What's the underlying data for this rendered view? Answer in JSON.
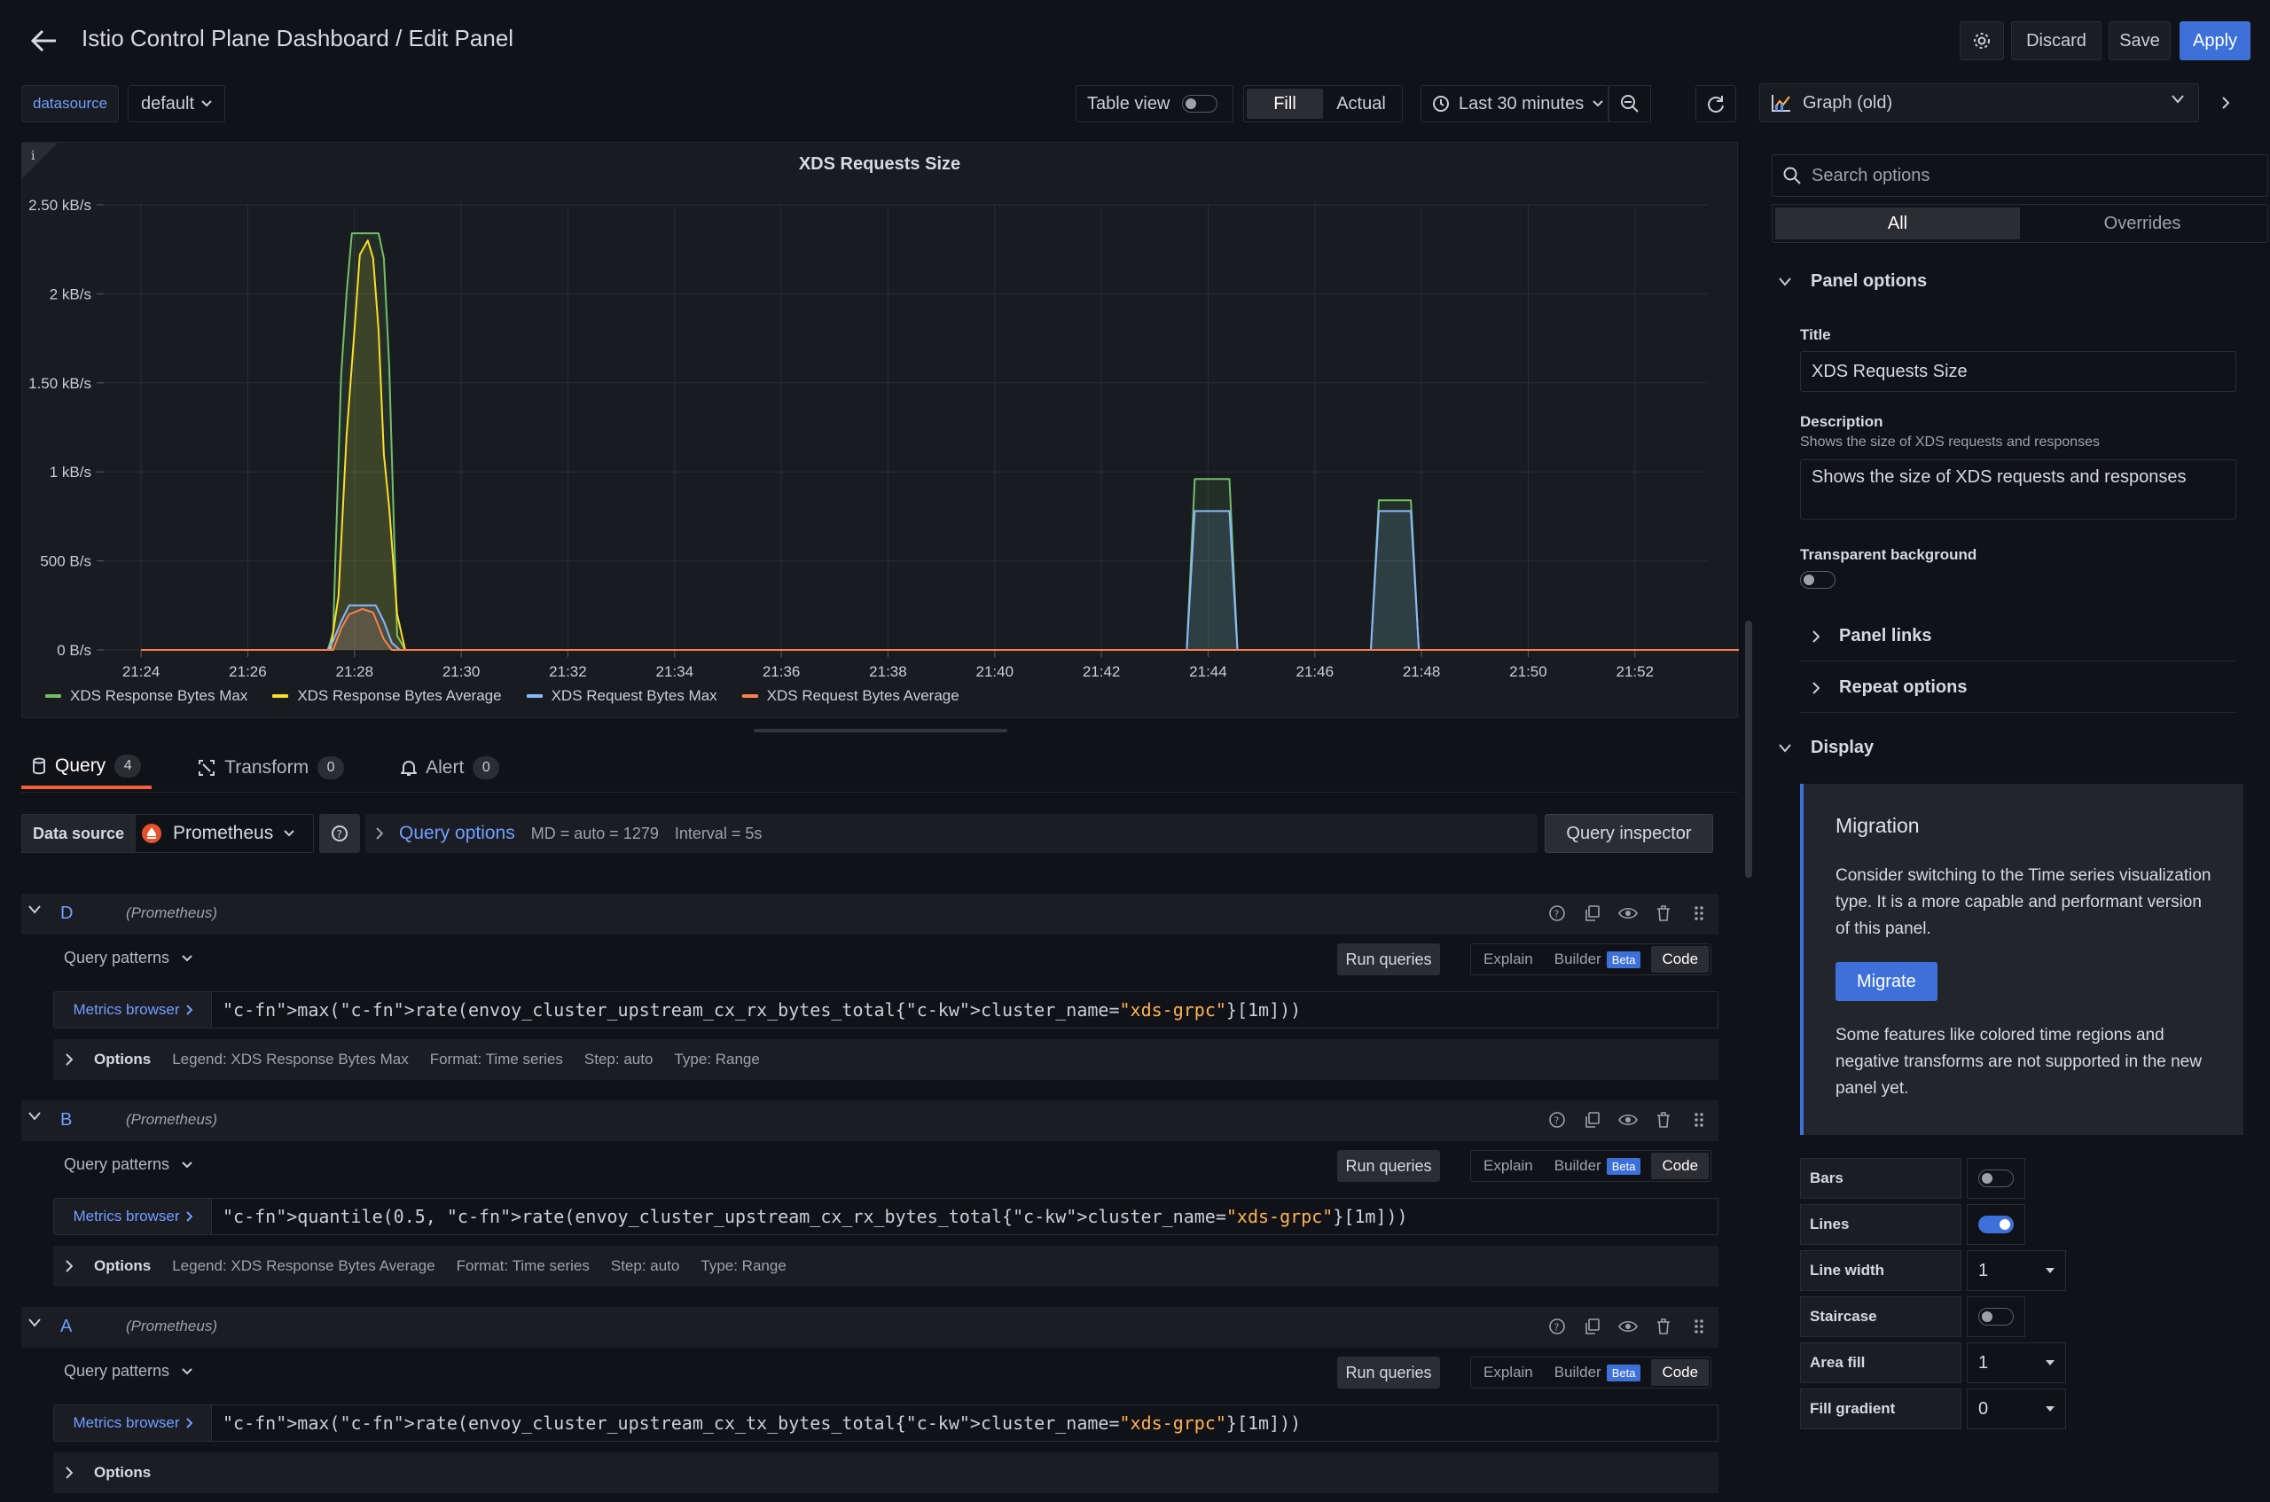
{
  "header": {
    "title": "Istio Control Plane Dashboard / Edit Panel",
    "discard": "Discard",
    "save": "Save",
    "apply": "Apply"
  },
  "toolbar": {
    "datasource_label": "datasource",
    "datasource_value": "default",
    "table_view": "Table view",
    "fill": "Fill",
    "actual": "Actual",
    "time_range": "Last 30 minutes",
    "visualization": "Graph (old)"
  },
  "chart_data": {
    "type": "line",
    "title": "XDS Requests Size",
    "x_ticks": [
      "21:24",
      "21:26",
      "21:28",
      "21:30",
      "21:32",
      "21:34",
      "21:36",
      "21:38",
      "21:40",
      "21:42",
      "21:44",
      "21:46",
      "21:48",
      "21:50",
      "21:52"
    ],
    "y_ticks": [
      "0 B/s",
      "500 B/s",
      "1 kB/s",
      "1.50 kB/s",
      "2 kB/s",
      "2.50 kB/s"
    ],
    "ylim": [
      0,
      2500
    ],
    "x_unit": "minutes since 21:24",
    "grid": true,
    "legend_position": "bottom-left",
    "series": [
      {
        "name": "XDS Response Bytes Max",
        "color": "#73bf69",
        "points": [
          [
            0,
            0
          ],
          [
            3.5,
            0
          ],
          [
            3.6,
            100
          ],
          [
            3.75,
            1540
          ],
          [
            3.85,
            2000
          ],
          [
            3.95,
            2340
          ],
          [
            4.45,
            2340
          ],
          [
            4.55,
            2200
          ],
          [
            4.65,
            1600
          ],
          [
            4.8,
            80
          ],
          [
            4.95,
            0
          ],
          [
            19.6,
            0
          ],
          [
            19.75,
            960
          ],
          [
            20.4,
            960
          ],
          [
            20.55,
            0
          ],
          [
            23.05,
            0
          ],
          [
            23.2,
            840
          ],
          [
            23.8,
            840
          ],
          [
            23.95,
            0
          ],
          [
            30,
            0
          ]
        ]
      },
      {
        "name": "XDS Response Bytes Average",
        "color": "#fade2a",
        "points": [
          [
            0,
            0
          ],
          [
            3.55,
            0
          ],
          [
            3.7,
            300
          ],
          [
            3.85,
            1200
          ],
          [
            4.0,
            1800
          ],
          [
            4.1,
            2220
          ],
          [
            4.25,
            2300
          ],
          [
            4.35,
            2200
          ],
          [
            4.45,
            1800
          ],
          [
            4.55,
            1100
          ],
          [
            4.65,
            800
          ],
          [
            4.8,
            200
          ],
          [
            4.95,
            0
          ],
          [
            30,
            0
          ]
        ]
      },
      {
        "name": "XDS Request Bytes Max",
        "color": "#8ab8ff",
        "points": [
          [
            0,
            0
          ],
          [
            3.5,
            0
          ],
          [
            3.6,
            50
          ],
          [
            3.75,
            160
          ],
          [
            3.9,
            250
          ],
          [
            4.4,
            250
          ],
          [
            4.55,
            160
          ],
          [
            4.7,
            40
          ],
          [
            4.85,
            0
          ],
          [
            19.6,
            0
          ],
          [
            19.75,
            780
          ],
          [
            20.4,
            780
          ],
          [
            20.55,
            0
          ],
          [
            23.05,
            0
          ],
          [
            23.2,
            780
          ],
          [
            23.8,
            780
          ],
          [
            23.95,
            0
          ],
          [
            30,
            0
          ]
        ]
      },
      {
        "name": "XDS Request Bytes Average",
        "color": "#ff7f4a",
        "points": [
          [
            0,
            0
          ],
          [
            3.6,
            0
          ],
          [
            3.75,
            120
          ],
          [
            3.9,
            200
          ],
          [
            4.15,
            230
          ],
          [
            4.35,
            210
          ],
          [
            4.55,
            60
          ],
          [
            4.7,
            0
          ],
          [
            30,
            0
          ]
        ]
      }
    ]
  },
  "query_tabs": [
    {
      "label": "Query",
      "count": "4"
    },
    {
      "label": "Transform",
      "count": "0"
    },
    {
      "label": "Alert",
      "count": "0"
    }
  ],
  "datasource_row": {
    "label": "Data source",
    "value": "Prometheus",
    "query_options": "Query options",
    "md": "MD = auto = 1279",
    "interval": "Interval = 5s",
    "inspector": "Query inspector"
  },
  "queries": [
    {
      "letter": "D",
      "ds": "(Prometheus)",
      "patterns": "Query patterns",
      "run": "Run queries",
      "modes": [
        "Explain",
        "Builder",
        "Beta",
        "Code"
      ],
      "metrics": "Metrics browser",
      "code": "max(rate(envoy_cluster_upstream_cx_rx_bytes_total{cluster_name=\"xds-grpc\"}[1m]))",
      "options": "Options",
      "legend": "Legend: XDS Response Bytes Max",
      "format": "Format: Time series",
      "step": "Step: auto",
      "qtype": "Type: Range"
    },
    {
      "letter": "B",
      "ds": "(Prometheus)",
      "patterns": "Query patterns",
      "run": "Run queries",
      "modes": [
        "Explain",
        "Builder",
        "Beta",
        "Code"
      ],
      "metrics": "Metrics browser",
      "code": "quantile(0.5, rate(envoy_cluster_upstream_cx_rx_bytes_total{cluster_name=\"xds-grpc\"}[1m]))",
      "options": "Options",
      "legend": "Legend: XDS Response Bytes Average",
      "format": "Format: Time series",
      "step": "Step: auto",
      "qtype": "Type: Range"
    },
    {
      "letter": "A",
      "ds": "(Prometheus)",
      "patterns": "Query patterns",
      "run": "Run queries",
      "modes": [
        "Explain",
        "Builder",
        "Beta",
        "Code"
      ],
      "metrics": "Metrics browser",
      "code": "max(rate(envoy_cluster_upstream_cx_tx_bytes_total{cluster_name=\"xds-grpc\"}[1m]))",
      "options": "Options",
      "legend": "",
      "format": "",
      "step": "",
      "qtype": ""
    }
  ],
  "options_pane": {
    "search_placeholder": "Search options",
    "tab_all": "All",
    "tab_overrides": "Overrides",
    "panel_options": "Panel options",
    "title_label": "Title",
    "title_value": "XDS Requests Size",
    "description_label": "Description",
    "description_help": "Shows the size of XDS requests and responses",
    "description_value": "Shows the size of XDS requests and responses",
    "transparent_label": "Transparent background",
    "panel_links": "Panel links",
    "repeat_options": "Repeat options",
    "display": "Display",
    "migration_title": "Migration",
    "migration_text": "Consider switching to the Time series visualization type. It is a more capable and performant version of this panel.",
    "migrate_button": "Migrate",
    "migration_note": "Some features like colored time regions and negative transforms are not supported in the new panel yet.",
    "bars": "Bars",
    "lines": "Lines",
    "line_width": "Line width",
    "line_width_value": "1",
    "staircase": "Staircase",
    "area_fill": "Area fill",
    "area_fill_value": "1",
    "fill_gradient": "Fill gradient",
    "fill_gradient_value": "0"
  }
}
